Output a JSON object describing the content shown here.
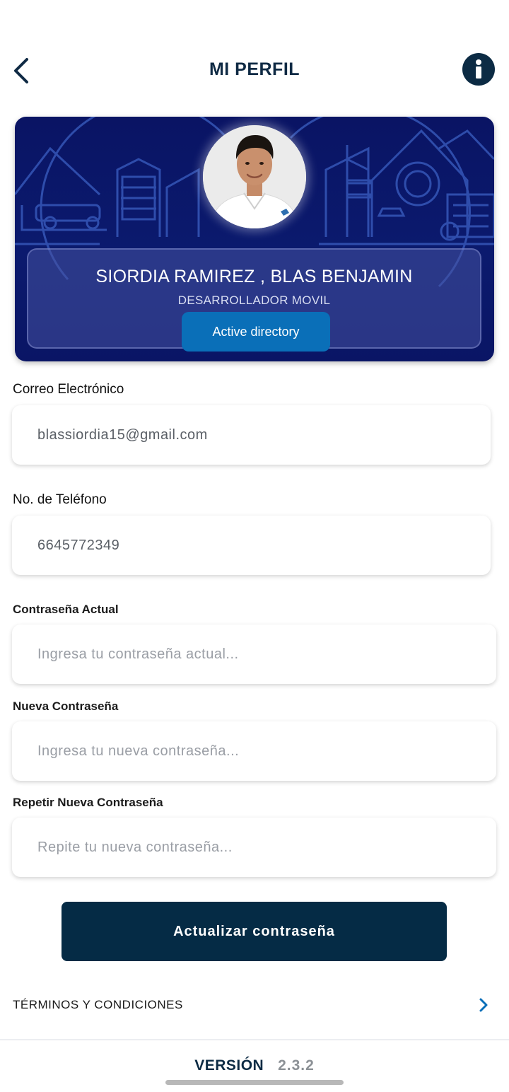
{
  "header": {
    "title": "MI PERFIL",
    "back_icon": "chevron-left-icon",
    "info_icon": "info-icon"
  },
  "profile": {
    "name": "SIORDIA  RAMIREZ , BLAS BENJAMIN",
    "role": "DESARROLLADOR MOVIL",
    "auth_button": "Active directory"
  },
  "form": {
    "email": {
      "label": "Correo Electrónico",
      "value": "blassiordia15@gmail.com"
    },
    "phone": {
      "label": "No. de Teléfono",
      "value": "6645772349"
    },
    "current_password": {
      "label": "Contraseña Actual",
      "placeholder": "Ingresa tu contraseña actual..."
    },
    "new_password": {
      "label": "Nueva Contraseña",
      "placeholder": "Ingresa tu nueva contraseña..."
    },
    "repeat_password": {
      "label": "Repetir Nueva Contraseña",
      "placeholder": "Repite tu nueva contraseña..."
    },
    "submit_label": "Actualizar contraseña"
  },
  "terms": {
    "label": "TÉRMINOS Y CONDICIONES"
  },
  "footer": {
    "version_label": "VERSIÓN",
    "version_number": "2.3.2"
  },
  "colors": {
    "primary_dark": "#052b45",
    "accent_blue": "#0a6fb8",
    "card_navy": "#0a1464"
  }
}
